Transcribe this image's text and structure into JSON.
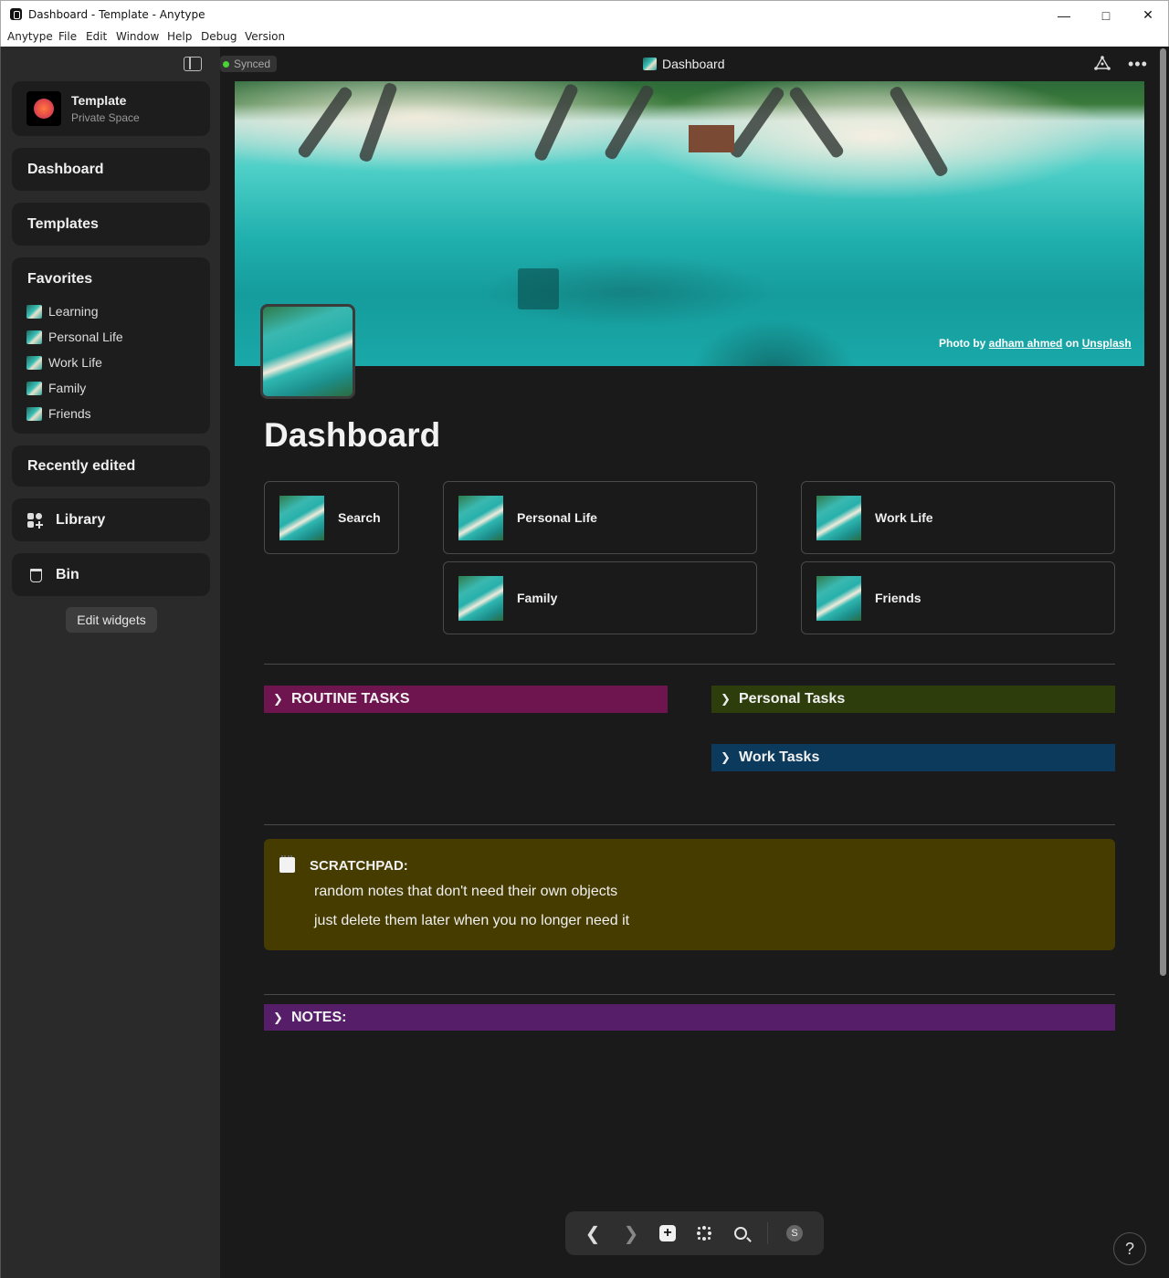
{
  "window": {
    "title": "Dashboard - Template - Anytype"
  },
  "menubar": [
    "Anytype",
    "File",
    "Edit",
    "Window",
    "Help",
    "Debug",
    "Version"
  ],
  "sidebar": {
    "space": {
      "name": "Template",
      "subtitle": "Private Space"
    },
    "widgets": {
      "dashboard": "Dashboard",
      "templates": "Templates",
      "favorites": "Favorites",
      "recently_edited": "Recently edited",
      "library": "Library",
      "bin": "Bin"
    },
    "favorites": [
      "Learning",
      "Personal Life",
      "Work Life",
      "Family",
      "Friends"
    ],
    "edit_widgets": "Edit widgets"
  },
  "header": {
    "sync_status": "Synced",
    "page_name": "Dashboard"
  },
  "cover": {
    "credit_prefix": "Photo by",
    "credit_author": "adham ahmed",
    "credit_on": "on",
    "credit_site": "Unsplash"
  },
  "main": {
    "title": "Dashboard",
    "links": [
      "Search",
      "Personal Life",
      "Work Life",
      "Family",
      "Friends"
    ],
    "toggles": {
      "routine": "ROUTINE TASKS",
      "personal": "Personal Tasks",
      "work": "Work Tasks",
      "notes": "NOTES:"
    },
    "scratchpad": {
      "title": "SCRATCHPAD:",
      "lines": [
        "random notes that don't need their own objects",
        "just delete them later when you no longer need it"
      ]
    }
  },
  "navbar": {
    "avatar_letter": "S"
  },
  "help": "?",
  "colors": {
    "routine": "#6e154f",
    "personal": "#2d3d0b",
    "work": "#0b3a5c",
    "notes": "#561e69",
    "scratchpad": "#463c00",
    "synced_dot": "#4cd137"
  }
}
